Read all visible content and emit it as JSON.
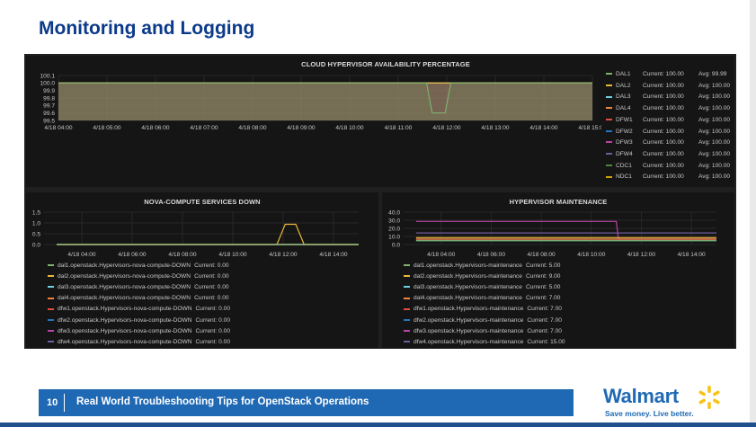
{
  "slide": {
    "title": "Monitoring and Logging",
    "footer_number": "10",
    "footer_text": "Real World Troubleshooting Tips for OpenStack Operations",
    "logo_text": "Walmart",
    "logo_tagline": "Save money. Live better."
  },
  "colors": {
    "title": "#0c3a8a",
    "footer": "#1f69b4",
    "panel_bg": "#151515",
    "grid": "#2d2d2d"
  },
  "chart_data": [
    {
      "type": "line",
      "title": "CLOUD HYPERVISOR AVAILABILITY PERCENTAGE",
      "x_ticks": [
        "4/18 04:00",
        "4/18 05:00",
        "4/18 06:00",
        "4/18 07:00",
        "4/18 08:00",
        "4/18 09:00",
        "4/18 10:00",
        "4/18 11:00",
        "4/18 12:00",
        "4/18 13:00",
        "4/18 14:00",
        "4/18 15:00"
      ],
      "y_ticks": [
        "100.1",
        "100.0",
        "99.9",
        "99.8",
        "99.7",
        "99.6",
        "99.5"
      ],
      "ylim": [
        99.5,
        100.1
      ],
      "fill": true,
      "series": [
        {
          "name": "DAL1",
          "color": "#7eb26d",
          "current": "100.00",
          "avg": "99.99",
          "points": [
            [
              "4/18 04:00",
              100.0
            ],
            [
              "4/18 11:35",
              100.0
            ],
            [
              "4/18 11:42",
              99.6
            ],
            [
              "4/18 11:58",
              99.6
            ],
            [
              "4/18 12:05",
              100.0
            ],
            [
              "4/18 15:00",
              100.0
            ]
          ]
        },
        {
          "name": "DAL2",
          "color": "#eab839",
          "current": "100.00",
          "avg": "100.00",
          "points": [
            [
              "4/18 04:00",
              100.0
            ],
            [
              "4/18 15:00",
              100.0
            ]
          ]
        },
        {
          "name": "DAL3",
          "color": "#6ed0e0",
          "current": "100.00",
          "avg": "100.00",
          "points": [
            [
              "4/18 04:00",
              100.0
            ],
            [
              "4/18 15:00",
              100.0
            ]
          ]
        },
        {
          "name": "DAL4",
          "color": "#ef843c",
          "current": "100.00",
          "avg": "100.00",
          "points": [
            [
              "4/18 04:00",
              100.0
            ],
            [
              "4/18 15:00",
              100.0
            ]
          ]
        },
        {
          "name": "DFW1",
          "color": "#e24d42",
          "current": "100.00",
          "avg": "100.00",
          "points": [
            [
              "4/18 04:00",
              100.0
            ],
            [
              "4/18 15:00",
              100.0
            ]
          ]
        },
        {
          "name": "DFW2",
          "color": "#1f78c1",
          "current": "100.00",
          "avg": "100.00",
          "points": [
            [
              "4/18 04:00",
              100.0
            ],
            [
              "4/18 15:00",
              100.0
            ]
          ]
        },
        {
          "name": "DFW3",
          "color": "#ba43a9",
          "current": "100.00",
          "avg": "100.00",
          "points": [
            [
              "4/18 04:00",
              100.0
            ],
            [
              "4/18 15:00",
              100.0
            ]
          ]
        },
        {
          "name": "DFW4",
          "color": "#705da0",
          "current": "100.00",
          "avg": "100.00",
          "points": [
            [
              "4/18 04:00",
              100.0
            ],
            [
              "4/18 15:00",
              100.0
            ]
          ]
        },
        {
          "name": "CDC1",
          "color": "#508642",
          "current": "100.00",
          "avg": "100.00",
          "points": [
            [
              "4/18 04:00",
              100.0
            ],
            [
              "4/18 15:00",
              100.0
            ]
          ]
        },
        {
          "name": "NDC1",
          "color": "#cca300",
          "current": "100.00",
          "avg": "100.00",
          "points": [
            [
              "4/18 04:00",
              100.0
            ],
            [
              "4/18 15:00",
              100.0
            ]
          ]
        }
      ]
    },
    {
      "type": "line",
      "title": "NOVA-COMPUTE SERVICES DOWN",
      "x_ticks": [
        "4/18 04:00",
        "4/18 06:00",
        "4/18 08:00",
        "4/18 10:00",
        "4/18 12:00",
        "4/18 14:00"
      ],
      "y_ticks": [
        "1.5",
        "1.0",
        "0.5",
        "0.0"
      ],
      "ylim": [
        0,
        1.6
      ],
      "fill": false,
      "series": [
        {
          "name": "dal1.openstack.Hypervisors-nova-compute-DOWN",
          "color": "#7eb26d",
          "current": "0.00",
          "points": [
            [
              "4/18 03:00",
              0
            ],
            [
              "4/18 15:00",
              0
            ]
          ]
        },
        {
          "name": "dal2.openstack.Hypervisors-nova-compute-DOWN",
          "color": "#eab839",
          "current": "0.00",
          "points": [
            [
              "4/18 03:00",
              0
            ],
            [
              "4/18 11:45",
              0
            ],
            [
              "4/18 12:05",
              1.0
            ],
            [
              "4/18 12:30",
              1.0
            ],
            [
              "4/18 12:50",
              0
            ],
            [
              "4/18 15:00",
              0
            ]
          ]
        },
        {
          "name": "dal3.openstack.Hypervisors-nova-compute-DOWN",
          "color": "#6ed0e0",
          "current": "0.00",
          "points": [
            [
              "4/18 03:00",
              0
            ],
            [
              "4/18 15:00",
              0
            ]
          ]
        },
        {
          "name": "dal4.openstack.Hypervisors-nova-compute-DOWN",
          "color": "#ef843c",
          "current": "0.00",
          "points": [
            [
              "4/18 03:00",
              0
            ],
            [
              "4/18 15:00",
              0
            ]
          ]
        },
        {
          "name": "dfw1.openstack.Hypervisors-nova-compute-DOWN",
          "color": "#e24d42",
          "current": "0.00",
          "points": [
            [
              "4/18 03:00",
              0
            ],
            [
              "4/18 15:00",
              0
            ]
          ]
        },
        {
          "name": "dfw2.openstack.Hypervisors-nova-compute-DOWN",
          "color": "#1f78c1",
          "current": "0.00",
          "points": [
            [
              "4/18 03:00",
              0
            ],
            [
              "4/18 15:00",
              0
            ]
          ]
        },
        {
          "name": "dfw3.openstack.Hypervisors-nova-compute-DOWN",
          "color": "#ba43a9",
          "current": "0.00",
          "points": [
            [
              "4/18 03:00",
              0
            ],
            [
              "4/18 15:00",
              0
            ]
          ]
        },
        {
          "name": "dfw4.openstack.Hypervisors-nova-compute-DOWN",
          "color": "#705da0",
          "current": "0.00",
          "points": [
            [
              "4/18 03:00",
              0
            ],
            [
              "4/18 15:00",
              0
            ]
          ]
        }
      ]
    },
    {
      "type": "line",
      "title": "HYPERVISOR MAINTENANCE",
      "x_ticks": [
        "4/18 04:00",
        "4/18 06:00",
        "4/18 08:00",
        "4/18 10:00",
        "4/18 12:00",
        "4/18 14:00"
      ],
      "y_ticks": [
        "40.0",
        "30.0",
        "20.0",
        "10.0",
        "0.0"
      ],
      "ylim": [
        0,
        42
      ],
      "fill": false,
      "series": [
        {
          "name": "dal1.openstack.Hypervisors-maintenance",
          "color": "#7eb26d",
          "current": "5.00",
          "points": [
            [
              "4/18 03:00",
              5
            ],
            [
              "4/18 15:00",
              5
            ]
          ]
        },
        {
          "name": "dal2.openstack.Hypervisors-maintenance",
          "color": "#eab839",
          "current": "9.00",
          "points": [
            [
              "4/18 03:00",
              9
            ],
            [
              "4/18 15:00",
              9
            ]
          ]
        },
        {
          "name": "dal3.openstack.Hypervisors-maintenance",
          "color": "#6ed0e0",
          "current": "5.00",
          "points": [
            [
              "4/18 03:00",
              5
            ],
            [
              "4/18 15:00",
              5
            ]
          ]
        },
        {
          "name": "dal4.openstack.Hypervisors-maintenance",
          "color": "#ef843c",
          "current": "7.00",
          "points": [
            [
              "4/18 03:00",
              7
            ],
            [
              "4/18 15:00",
              7
            ]
          ]
        },
        {
          "name": "dfw1.openstack.Hypervisors-maintenance",
          "color": "#e24d42",
          "current": "7.00",
          "points": [
            [
              "4/18 03:00",
              7
            ],
            [
              "4/18 15:00",
              7
            ]
          ]
        },
        {
          "name": "dfw2.openstack.Hypervisors-maintenance",
          "color": "#1f78c1",
          "current": "7.00",
          "points": [
            [
              "4/18 03:00",
              7
            ],
            [
              "4/18 15:00",
              7
            ]
          ]
        },
        {
          "name": "dfw3.openstack.Hypervisors-maintenance",
          "color": "#ba43a9",
          "current": "7.00",
          "points": [
            [
              "4/18 03:00",
              30
            ],
            [
              "4/18 11:00",
              30
            ],
            [
              "4/18 11:05",
              7
            ],
            [
              "4/18 15:00",
              7
            ]
          ]
        },
        {
          "name": "dfw4.openstack.Hypervisors-maintenance",
          "color": "#705da0",
          "current": "15.00",
          "points": [
            [
              "4/18 03:00",
              15
            ],
            [
              "4/18 15:00",
              15
            ]
          ]
        }
      ]
    }
  ]
}
